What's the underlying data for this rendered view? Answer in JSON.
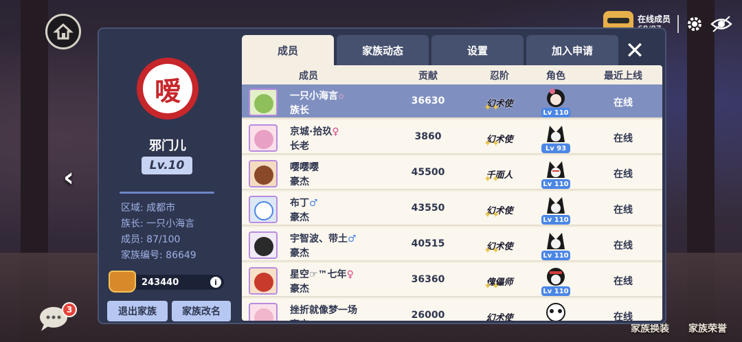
{
  "top_right": {
    "online_label": "在线成员",
    "online_count": "68/87"
  },
  "chat": {
    "badge": "3"
  },
  "bottom_right": {
    "exchange_label": "家族换装",
    "honor_label": "家族荣誉"
  },
  "family": {
    "emblem_char": "嗳",
    "name": "邪门儿",
    "level": "Lv.10",
    "region": "区域: 成都市",
    "leader": "族长: 一只小海言",
    "members": "成员: 87/100",
    "family_id": "家族编号: 86649",
    "funds": "243440",
    "leave_button": "退出家族",
    "rename_button": "家族改名"
  },
  "tabs": [
    {
      "label": "成员"
    },
    {
      "label": "家族动态"
    },
    {
      "label": "设置"
    },
    {
      "label": "加入申请"
    }
  ],
  "table": {
    "headers": {
      "member": "成员",
      "contribution": "贡献",
      "ninja_rank": "忍阶",
      "role": "角色",
      "last_online": "最近上线"
    },
    "rows": [
      {
        "name": "一只小海言",
        "name_suffix": "✿",
        "rank": "族长",
        "contribution": "36630",
        "ninja_rank": "幻术使",
        "level": "Lv 110",
        "status": "在线"
      },
      {
        "name": "京城·拾玖",
        "name_suffix": "♀",
        "rank": "长老",
        "contribution": "3860",
        "ninja_rank": "幻术使",
        "level": "Lv 93",
        "status": "在线"
      },
      {
        "name": "嘤嘤嘤",
        "name_suffix": "",
        "rank": "豪杰",
        "contribution": "45500",
        "ninja_rank": "千面人",
        "level": "Lv 110",
        "status": "在线"
      },
      {
        "name": "布丁",
        "name_suffix": "♂",
        "rank": "豪杰",
        "contribution": "43550",
        "ninja_rank": "幻术使",
        "level": "Lv 110",
        "status": "在线"
      },
      {
        "name": "宇智波、带土",
        "name_suffix": "♂",
        "rank": "豪杰",
        "contribution": "40515",
        "ninja_rank": "幻术使",
        "level": "Lv 110",
        "status": "在线"
      },
      {
        "name": "星空☞™七年",
        "name_suffix": "♀",
        "rank": "豪杰",
        "contribution": "36360",
        "ninja_rank": "傀儡师",
        "level": "Lv 110",
        "status": "在线"
      },
      {
        "name": "挫折就像梦一场",
        "name_suffix": "",
        "rank": "豪杰",
        "contribution": "26000",
        "ninja_rank": "幻术使",
        "level": "",
        "status": "在线"
      }
    ]
  },
  "colors": {
    "panel": "#2f3650",
    "table_bg": "#f4efe2",
    "selected_row": "#7f8fc0",
    "emblem_red": "#c7262a",
    "level_tag": "#4b86e6"
  }
}
